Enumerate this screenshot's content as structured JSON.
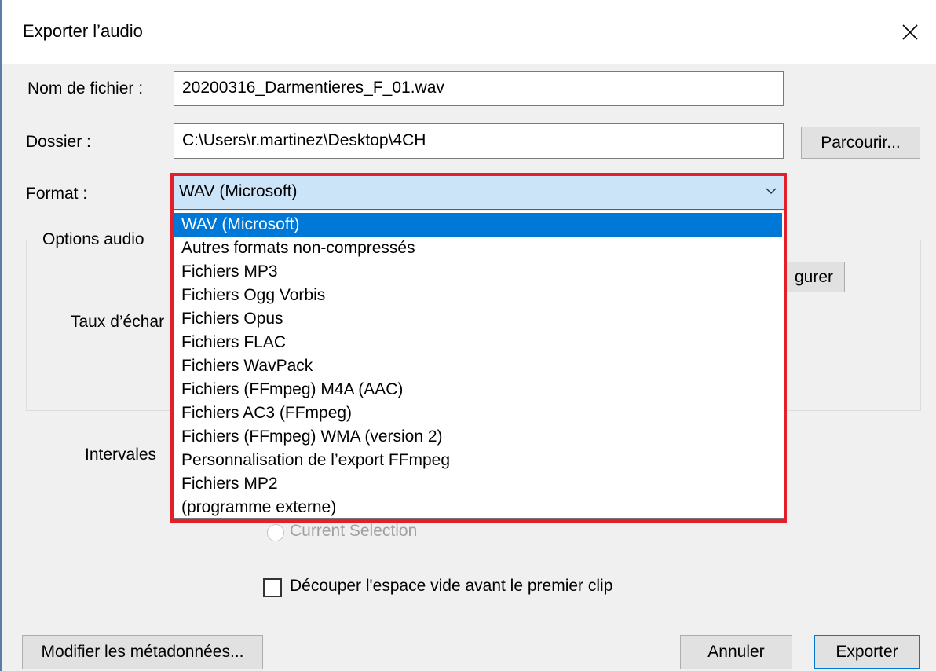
{
  "window": {
    "title": "Exporter l’audio",
    "close_icon": "close-icon"
  },
  "filename": {
    "label": "Nom de fichier :",
    "value": "20200316_Darmentieres_F_01.wav"
  },
  "folder": {
    "label": "Dossier :",
    "value": "C:\\Users\\r.martinez\\Desktop\\4CH",
    "browse_label": "Parcourir..."
  },
  "format": {
    "label": "Format :",
    "selected": "WAV (Microsoft)",
    "options": [
      "WAV (Microsoft)",
      "Autres formats non-compressés",
      "Fichiers MP3",
      "Fichiers Ogg Vorbis",
      "Fichiers Opus",
      "Fichiers FLAC",
      "Fichiers WavPack",
      "Fichiers (FFmpeg) M4A (AAC)",
      "Fichiers AC3 (FFmpeg)",
      "Fichiers (FFmpeg) WMA (version 2)",
      "Personnalisation de l’export FFmpeg",
      "Fichiers MP2",
      "(programme externe)"
    ]
  },
  "audio_options": {
    "legend": "Options audio",
    "sample_rate_label_partial": "Taux d’échar",
    "configure_partial": "gurer"
  },
  "range": {
    "label_partial": "Intervales",
    "current_selection_label": "Current Selection"
  },
  "trim": {
    "label": "Découper l'espace vide avant le premier clip",
    "checked": false
  },
  "footer": {
    "metadata_label": "Modifier les métadonnées...",
    "cancel_label": "Annuler",
    "export_label": "Exporter"
  },
  "colors": {
    "accent": "#0078d7",
    "highlight_border": "#e3202a",
    "combo_bg": "#cce4f7"
  }
}
